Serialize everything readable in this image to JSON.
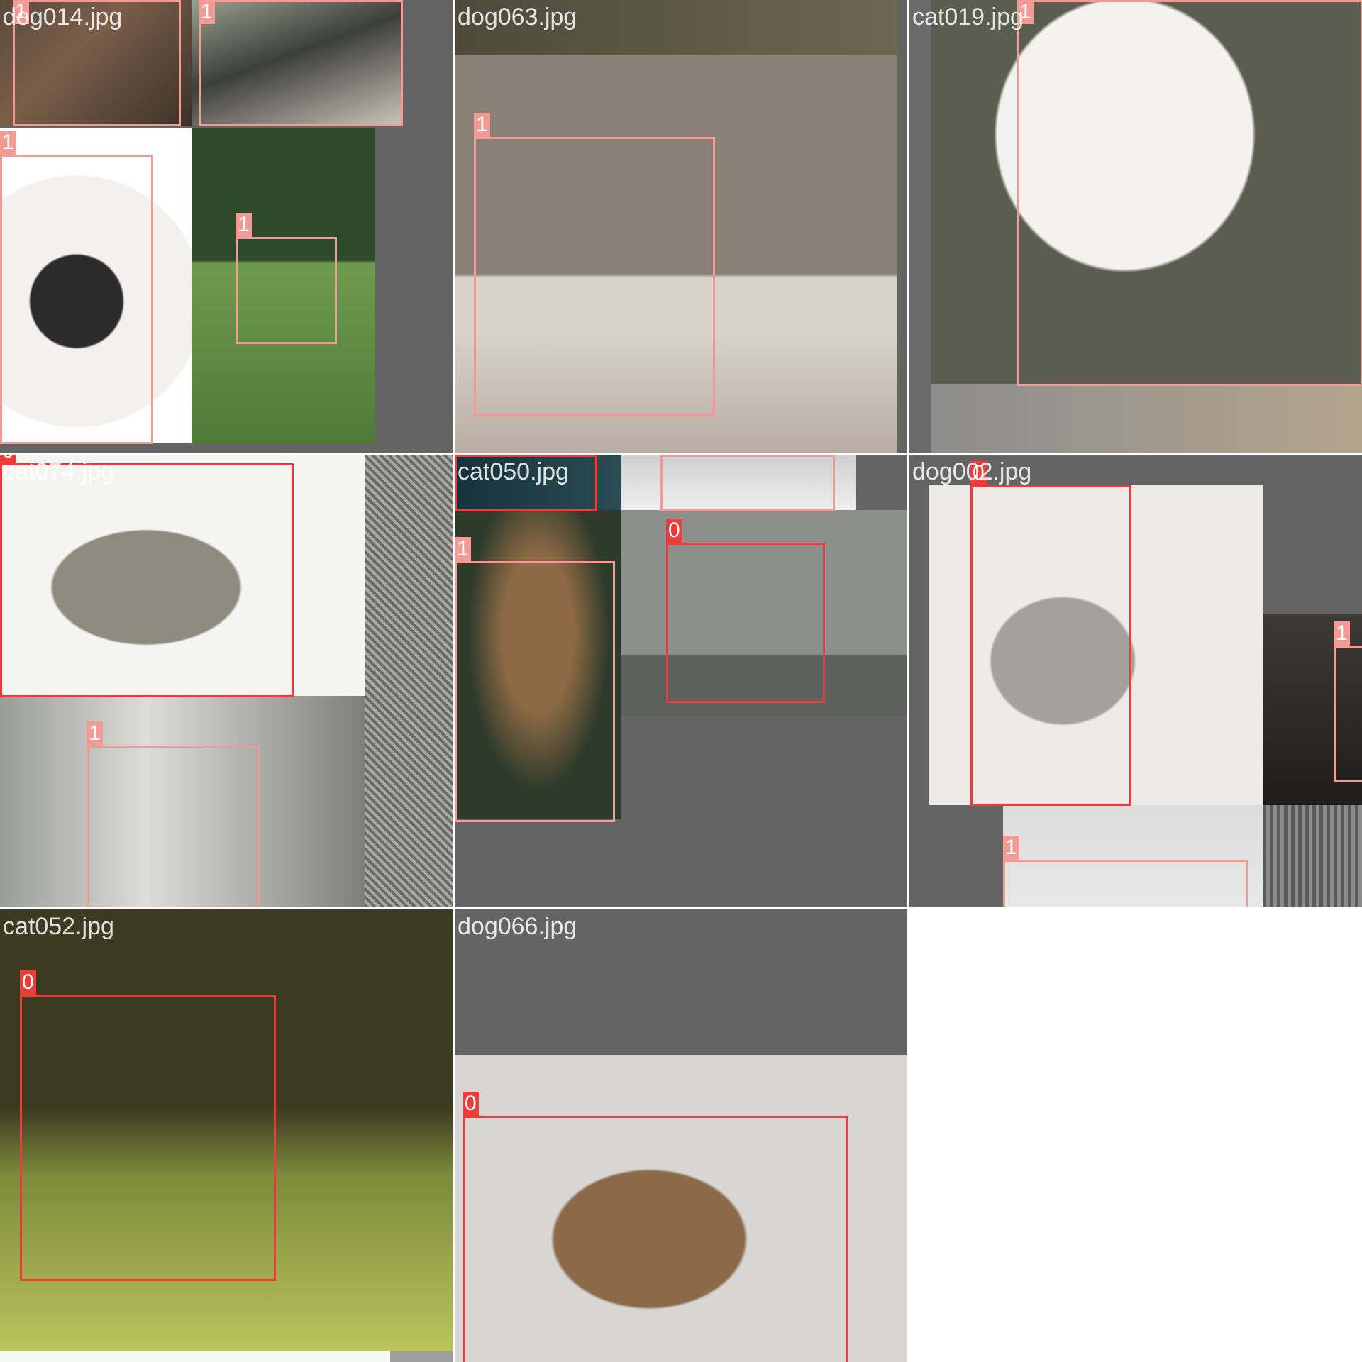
{
  "tiles": [
    {
      "filename": "dog014.jpg"
    },
    {
      "filename": "dog063.jpg"
    },
    {
      "filename": "cat019.jpg"
    },
    {
      "filename": "cat074.jpg"
    },
    {
      "filename": "cat050.jpg"
    },
    {
      "filename": "dog002.jpg"
    },
    {
      "filename": "cat052.jpg"
    },
    {
      "filename": "dog066.jpg"
    }
  ],
  "classes": {
    "cat": "0",
    "dog": "1"
  },
  "colors": {
    "class0": "#ec3b3b",
    "class1": "#f39a95",
    "padding": "#646464",
    "background": "#ffffff"
  }
}
